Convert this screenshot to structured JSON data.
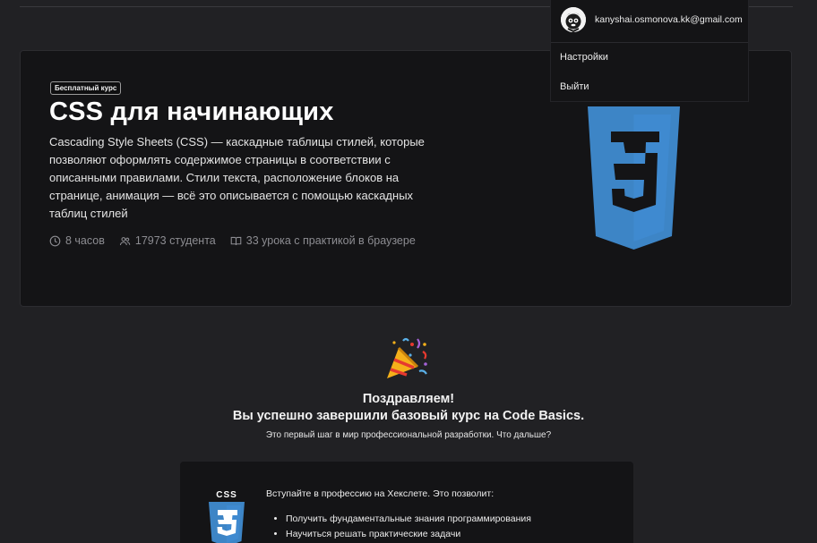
{
  "user_menu": {
    "email": "kanyshai.osmonova.kk@gmail.com",
    "items": [
      "Настройки",
      "Выйти"
    ]
  },
  "course": {
    "badge": "Бесплатный курс",
    "title": "CSS для начинающих",
    "description": "Cascading Style Sheets (CSS) — каскадные таблицы стилей, которые позволяют оформлять содержимое страницы в соответствии с описанными правилами. Стили текста, расположение блоков на странице, анимация — всё это описывается с помощью каскадных таблиц стилей",
    "meta": {
      "duration": "8 часов",
      "students": "17973 студента",
      "lessons": "33 урока с практикой в браузере"
    },
    "logo_icon": "css3-logo",
    "logo_color": "#3d85c6"
  },
  "congrats": {
    "icon": "party-popper-icon",
    "line1": "Поздравляем!",
    "line2": "Вы успешно завершили базовый курс на Code Basics.",
    "sub": "Это первый шаг в мир профессиональной разработки. Что дальше?"
  },
  "promo": {
    "logo_label": "CSS",
    "intro": "Вступайте в профессию на Хекслете. Это позволит:",
    "bullets": [
      "Получить фундаментальные знания программирования",
      "Научиться решать практические задачи"
    ]
  }
}
